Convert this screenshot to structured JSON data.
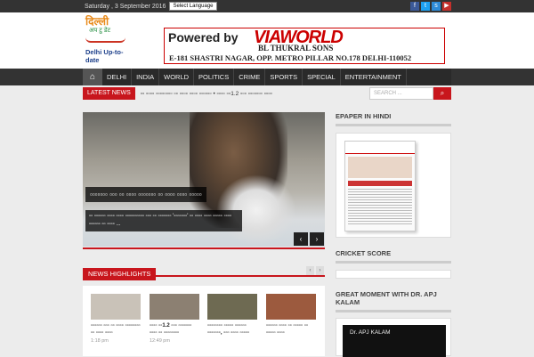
{
  "topbar": {
    "date": "Saturday , 3 September 2016",
    "language_select": "Select Language"
  },
  "logo": {
    "hindi": "दिल्ली",
    "sub": "अप टु डेट",
    "english": "Delhi Up-to-date"
  },
  "banner": {
    "powered": "Powered by",
    "brand": "VIAWORLD",
    "sub": "BL THUKRAL SONS",
    "address": "E-181 SHASTRI NAGAR, OPP. METRO PILLAR NO.178 DELHI-110052"
  },
  "nav": {
    "home_icon": "home-icon",
    "items": [
      "DELHI",
      "INDIA",
      "WORLD",
      "POLITICS",
      "CRIME",
      "SPORTS",
      "SPECIAL",
      "ENTERTAINMENT"
    ]
  },
  "ticker": {
    "label": "LATEST NEWS",
    "text": "▫▫ ▫▫▫▫ ▫▫▫▫▫▫▫▫ ▫▫ ▫▫▫▫ ▫▫▫▫ ▫▫▫▫▫▫ • ▫▫▫▫ ▫▫1.2 ▫▫▫ ▫▫▫▫▫▫▫ ▫▫▫▫",
    "search_placeholder": "SEARCH ..."
  },
  "slider": {
    "headline": "▫▫▫▫▫▫▫ ▫▫▫ ▫▫ ▫▫▫▫ ▫▫▫▫▫▫▫ ▫▫ ▫▫▫▫ ▫▫▫▫ ▫▫▫▫▫",
    "summary": "▫▫ ▫▫▫▫▫▫ ▫▫▫▫ ▫▫▫▫ ▫▫▫▫▫▫▫▫▫▫ ▫▫▫ ▫▫ ▫▫▫▫▫▫▫ '▫▫▫▫▫▫▫' ▫▫ ▫▫▫▫ ▫▫▫▫ ▫▫▫▫▫ ▫▫▫▫ ▫▫▫▫▫▫ ▫▫ ▫▫▫▫ ...",
    "prev": "‹",
    "next": "›"
  },
  "news_highlights": {
    "label": "NEWS HIGHLIGHTS",
    "prev": "‹",
    "next": "›",
    "cards": [
      {
        "title": "▫▫▫▫▫▫ ▫▫▫ ▫▫ ▫▫▫▫ ▫▫▫▫▫▫▫▫ ▫▫ ▫▫▫▫ ▫▫▫▫",
        "time": "1:18 pm",
        "color": "#c9c2b8"
      },
      {
        "title": "▫▫▫▫ ▫▫1.2 ▫▫▫ ▫▫▫▫▫▫▫ ▫▫▫▫ ▫▫ ▫▫▫▫▫▫▫▫",
        "time": "12:49 pm",
        "color": "#8c8072"
      },
      {
        "title": "▫▫▫▫▫▫▫▫ ▫▫▫▫▫ ▫▫▫▫▫▫ ▫▫▫▫▫▫▫, ▫▫▫ ▫▫▫▫ ▫▫▫▫▫",
        "time": "",
        "color": "#6e6a52"
      },
      {
        "title": "▫▫▫▫▫▫ ▫▫▫▫ ▫▫ ▫▫▫▫▫ ▫▫ ▫▫▫▫▫ ▫▫▫▫",
        "time": "",
        "color": "#9c5a3e"
      }
    ]
  },
  "sidebar": {
    "epaper_title": "EPAPER IN HINDI",
    "cricket_title": "CRICKET SCORE",
    "apj_title": "GREAT MOMENT WITH DR. APJ KALAM",
    "video_label": "Dr. APJ KALAM"
  }
}
